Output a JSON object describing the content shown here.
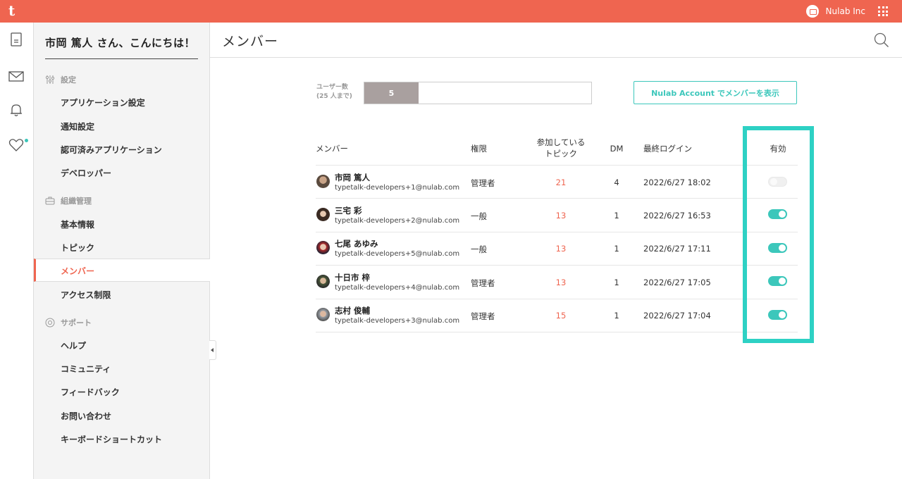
{
  "brand": {
    "logo": "t",
    "accent": "#ef6550",
    "teal": "#3cc7bb",
    "highlight": "#2ed1c4"
  },
  "topbar": {
    "org_name": "Nulab Inc"
  },
  "rail": {
    "icons": [
      "document-icon",
      "mail-icon",
      "bell-icon",
      "heart-icon"
    ]
  },
  "sidebar": {
    "greeting": "市岡 篤人 さん、こんにちは！",
    "sections": [
      {
        "title": "設定",
        "icon": "sliders-icon",
        "items": [
          "アプリケーション設定",
          "通知設定",
          "認可済みアプリケーション",
          "デベロッパー"
        ]
      },
      {
        "title": "組織管理",
        "icon": "org-icon",
        "items": [
          "基本情報",
          "トピック",
          "メンバー",
          "アクセス制限"
        ]
      },
      {
        "title": "サポート",
        "icon": "lifebuoy-icon",
        "items": [
          "ヘルプ",
          "コミュニティ",
          "フィードバック",
          "お問い合わせ",
          "キーボードショートカット"
        ]
      }
    ],
    "active_item": "メンバー"
  },
  "main": {
    "title": "メンバー",
    "user_count": {
      "label_line1": "ユーザー数",
      "label_line2": "(25 人まで)",
      "value": "5",
      "max": 25
    },
    "account_button": "Nulab Account でメンバーを表示",
    "table": {
      "headers": {
        "member": "メンバー",
        "role": "権限",
        "topics_line1": "参加している",
        "topics_line2": "トピック",
        "dm": "DM",
        "last_login": "最終ログイン",
        "enabled": "有効"
      },
      "rows": [
        {
          "name": "市岡 篤人",
          "email": "typetalk-developers+1@nulab.com",
          "role": "管理者",
          "topics": "21",
          "dm": "4",
          "last_login": "2022/6/27 18:02",
          "enabled": "disabled"
        },
        {
          "name": "三宅 彩",
          "email": "typetalk-developers+2@nulab.com",
          "role": "一般",
          "topics": "13",
          "dm": "1",
          "last_login": "2022/6/27 16:53",
          "enabled": "on"
        },
        {
          "name": "七尾 あゆみ",
          "email": "typetalk-developers+5@nulab.com",
          "role": "一般",
          "topics": "13",
          "dm": "1",
          "last_login": "2022/6/27 17:11",
          "enabled": "on"
        },
        {
          "name": "十日市 梓",
          "email": "typetalk-developers+4@nulab.com",
          "role": "管理者",
          "topics": "13",
          "dm": "1",
          "last_login": "2022/6/27 17:05",
          "enabled": "on"
        },
        {
          "name": "志村 俊輔",
          "email": "typetalk-developers+3@nulab.com",
          "role": "管理者",
          "topics": "15",
          "dm": "1",
          "last_login": "2022/6/27 17:04",
          "enabled": "on"
        }
      ]
    }
  }
}
